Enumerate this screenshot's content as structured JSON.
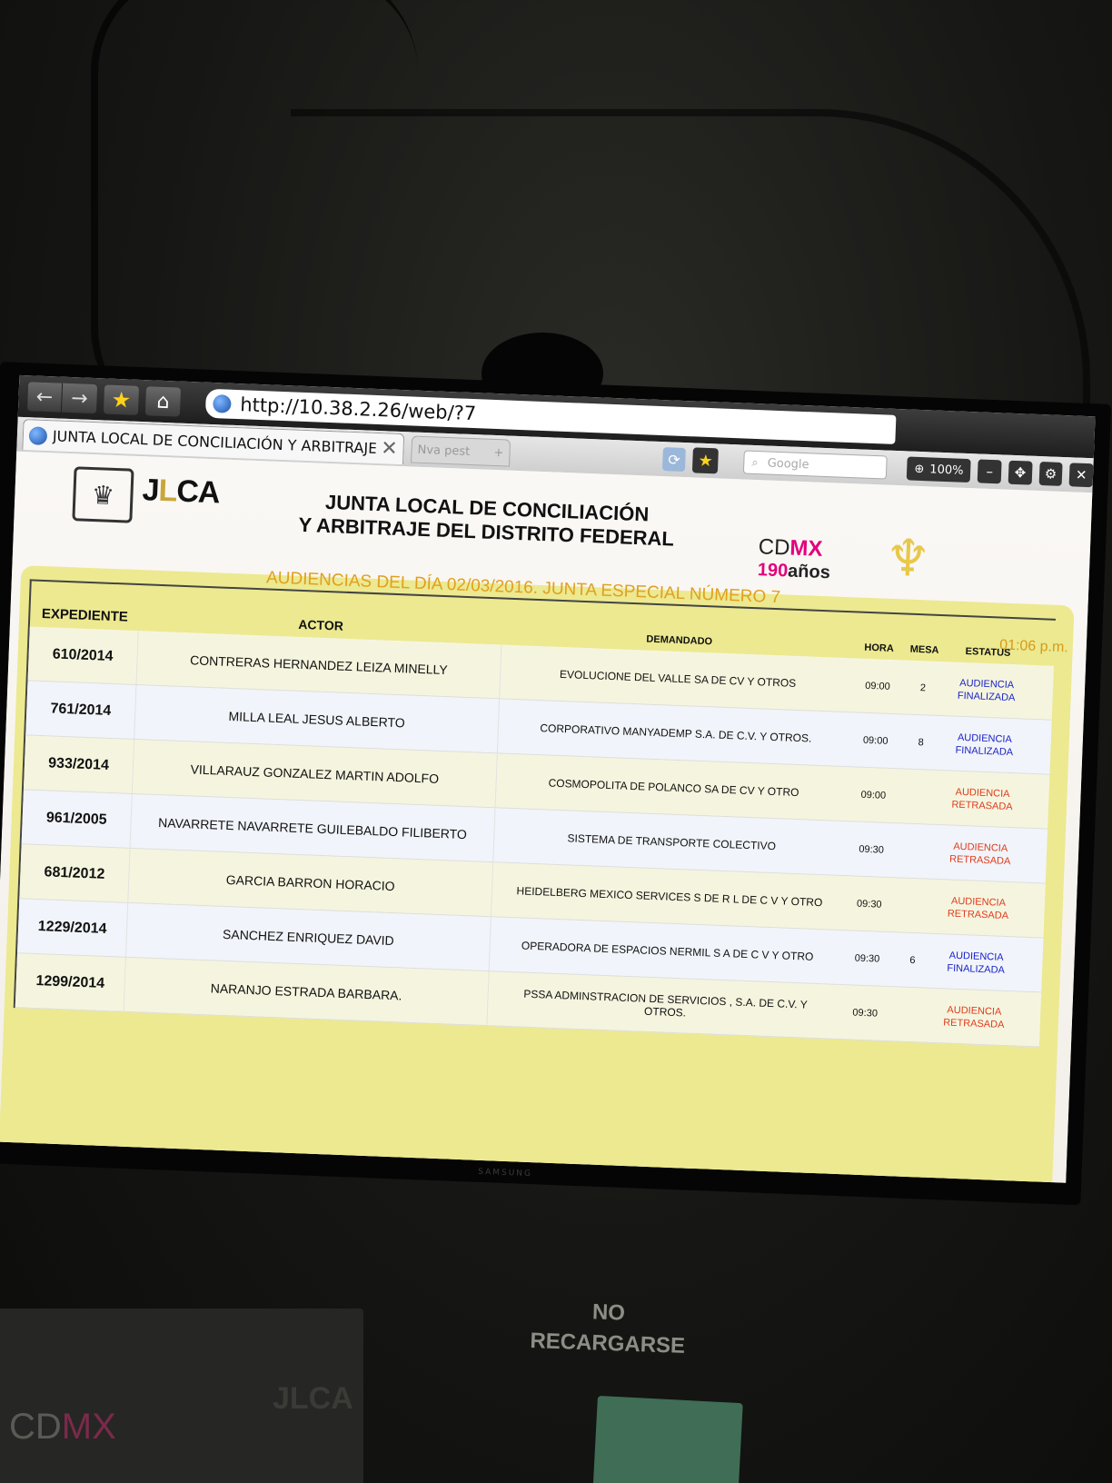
{
  "browser": {
    "url": "http://10.38.2.26/web/?7",
    "tab_title": "JUNTA LOCAL DE CONCILIACIÓN Y ARBITRAJE",
    "new_tab_label": "Nva pest",
    "search_placeholder": "Google",
    "zoom_level": "100%"
  },
  "header": {
    "org_line1": "JUNTA LOCAL DE CONCILIACIÓN",
    "org_line2": "Y ARBITRAJE DEL DISTRITO FEDERAL",
    "logo_text_j": "J",
    "logo_text_l": "L",
    "logo_text_ca": "CA",
    "cdmx_cd": "CD",
    "cdmx_mx": "MX",
    "anos_num": "190",
    "anos_word": "años"
  },
  "subtitle": "AUDIENCIAS DEL DÍA 02/03/2016. JUNTA ESPECIAL NÚMERO 7",
  "clock": "01:06 p.m.",
  "columns": {
    "expediente": "EXPEDIENTE",
    "actor": "ACTOR",
    "demandado": "DEMANDADO",
    "hora": "HORA",
    "mesa": "MESA",
    "estatus": "ESTATUS"
  },
  "rows": [
    {
      "expediente": "610/2014",
      "actor": "CONTRERAS HERNANDEZ LEIZA MINELLY",
      "demandado": "EVOLUCIONE DEL VALLE SA DE CV Y OTROS",
      "hora": "09:00",
      "mesa": "2",
      "estatus": "AUDIENCIA FINALIZADA"
    },
    {
      "expediente": "761/2014",
      "actor": "MILLA LEAL JESUS ALBERTO",
      "demandado": "CORPORATIVO MANYADEMP S.A. DE C.V. Y OTROS.",
      "hora": "09:00",
      "mesa": "8",
      "estatus": "AUDIENCIA FINALIZADA"
    },
    {
      "expediente": "933/2014",
      "actor": "VILLARAUZ GONZALEZ MARTIN ADOLFO",
      "demandado": "COSMOPOLITA DE POLANCO SA DE CV Y OTRO",
      "hora": "09:00",
      "mesa": "",
      "estatus": "AUDIENCIA RETRASADA"
    },
    {
      "expediente": "961/2005",
      "actor": "NAVARRETE NAVARRETE GUILEBALDO FILIBERTO",
      "demandado": "SISTEMA DE TRANSPORTE COLECTIVO",
      "hora": "09:30",
      "mesa": "",
      "estatus": "AUDIENCIA RETRASADA"
    },
    {
      "expediente": "681/2012",
      "actor": "GARCIA BARRON HORACIO",
      "demandado": "HEIDELBERG MEXICO SERVICES S DE R L DE C V Y OTRO",
      "hora": "09:30",
      "mesa": "",
      "estatus": "AUDIENCIA RETRASADA"
    },
    {
      "expediente": "1229/2014",
      "actor": "SANCHEZ ENRIQUEZ DAVID",
      "demandado": "OPERADORA DE ESPACIOS NERMIL S A DE C V Y OTRO",
      "hora": "09:30",
      "mesa": "6",
      "estatus": "AUDIENCIA FINALIZADA"
    },
    {
      "expediente": "1299/2014",
      "actor": "NARANJO ESTRADA BARBARA.",
      "demandado": "PSSA ADMINSTRACION DE SERVICIOS , S.A. DE C.V. Y OTROS.",
      "hora": "09:30",
      "mesa": "",
      "estatus": "AUDIENCIA RETRASADA"
    }
  ],
  "monitor_brand": "SAMSUNG",
  "wall": {
    "notice_line1": "NO",
    "notice_line2": "RECARGARSE",
    "poster_cd": "CD",
    "poster_mx": "MX",
    "poster_jlca": "JLCA"
  },
  "colors": {
    "status_finalizada": "#1a22c8",
    "status_retrasada": "#e03a1a",
    "subtitle": "#e0a020",
    "panel": "#ece990",
    "cdmx_pink": "#e4007c"
  }
}
